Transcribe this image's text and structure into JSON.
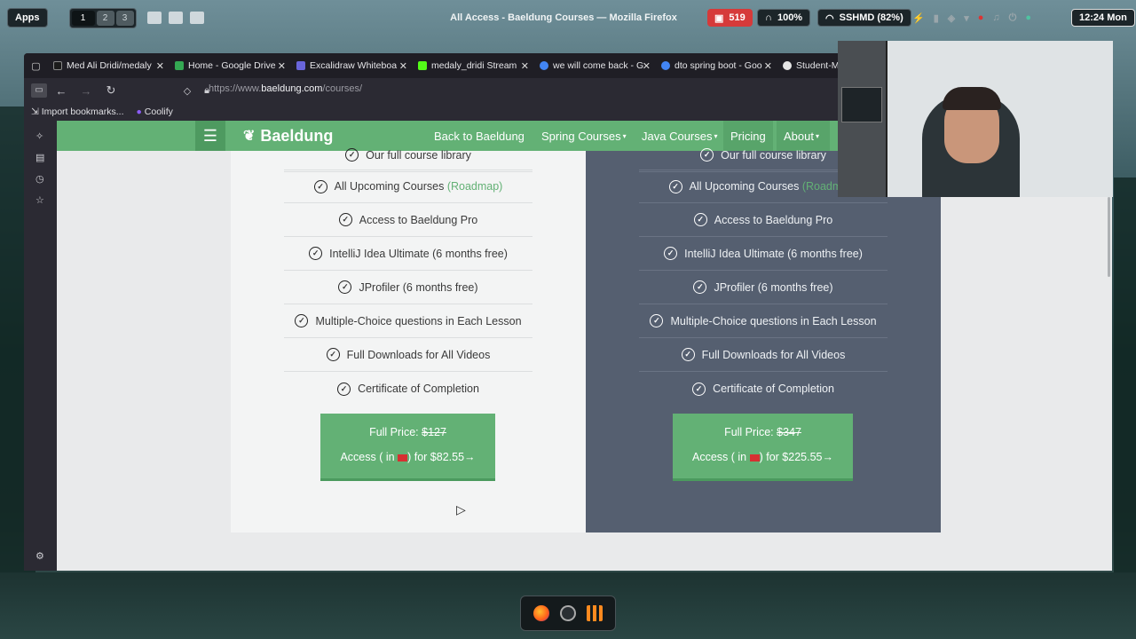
{
  "topbar": {
    "apps_label": "Apps",
    "workspaces": [
      "1",
      "2",
      "3"
    ],
    "window_title": "All Access - Baeldung Courses — Mozilla Firefox",
    "notifications_count": "519",
    "volume": "100%",
    "wifi": "SSHMD (82%)",
    "clock": "12:24 Mon"
  },
  "tabs": [
    {
      "label": "Med Ali Dridi/medaly",
      "favicon_color": "#1b1b1b"
    },
    {
      "label": "Home - Google Drive",
      "favicon_color": "#34a853"
    },
    {
      "label": "Excalidraw Whiteboa",
      "favicon_color": "#6965db"
    },
    {
      "label": "medaly_dridi Stream",
      "favicon_color": "#53fc18"
    },
    {
      "label": "we will come back - G",
      "favicon_color": "#4285f4"
    },
    {
      "label": "dto spring boot - Goo",
      "favicon_color": "#4285f4"
    },
    {
      "label": "Student-M",
      "favicon_color": "#e6e6e6"
    }
  ],
  "address": {
    "prefix": "https://www.",
    "domain": "baeldung.com",
    "path": "/courses/"
  },
  "bookmarks": [
    "Import bookmarks...",
    "Coolify"
  ],
  "site": {
    "logo": "Baeldung",
    "nav": [
      "Back to Baeldung",
      "Spring Courses",
      "Java Courses",
      "Pricing",
      "About"
    ]
  },
  "plans": [
    {
      "features": [
        "Our full course library",
        "All Upcoming Courses",
        "Access to Baeldung Pro",
        "IntelliJ Idea Ultimate (6 months free)",
        "JProfiler (6 months free)",
        "Multiple-Choice questions in Each Lesson",
        "Full Downloads for All Videos",
        "Certificate of Completion"
      ],
      "roadmap": "(Roadmap)",
      "full_price_label": "Full Price:",
      "full_price": "$127",
      "access_prefix": "Access ( in",
      "access_suffix": ") for $82.55→"
    },
    {
      "features": [
        "Our full course library",
        "All Upcoming Courses",
        "Access to Baeldung Pro",
        "IntelliJ Idea Ultimate (6 months free)",
        "JProfiler (6 months free)",
        "Multiple-Choice questions in Each Lesson",
        "Full Downloads for All Videos",
        "Certificate of Completion"
      ],
      "roadmap": "(Roadmap)",
      "full_price_label": "Full Price:",
      "full_price": "$347",
      "access_prefix": "Access ( in",
      "access_suffix": ") for $225.55→"
    }
  ],
  "colors": {
    "accent": "#63b175",
    "dark_card": "#555f70",
    "light_card": "#f3f4f4"
  }
}
